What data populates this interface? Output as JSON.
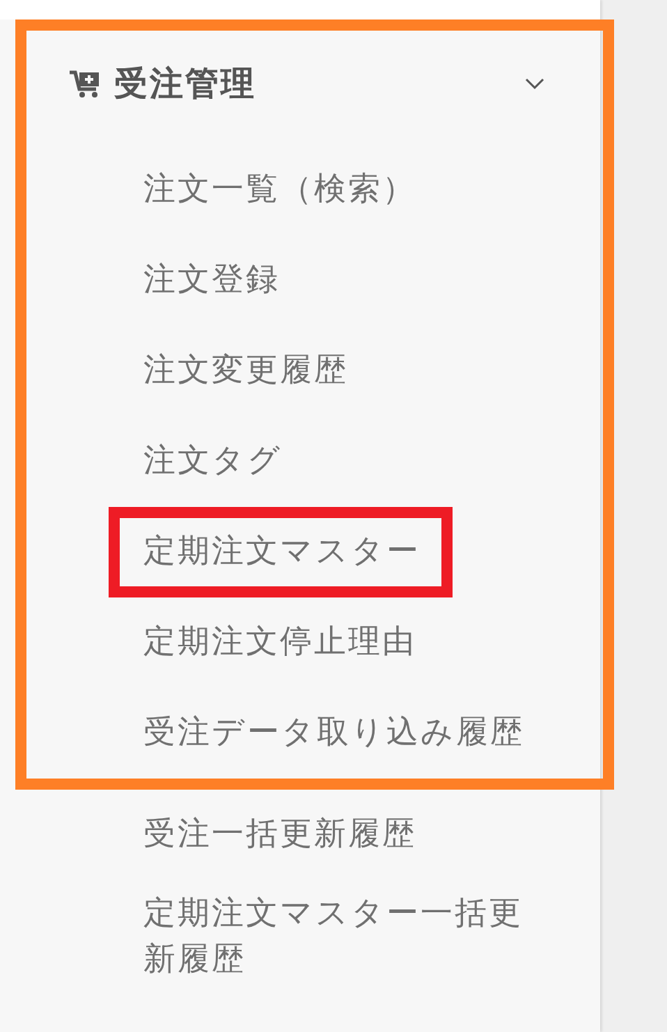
{
  "section": {
    "title": "受注管理",
    "expanded": true,
    "framed": true
  },
  "framed_items": [
    {
      "label": "注文一覧（検索）",
      "highlighted": false
    },
    {
      "label": "注文登録",
      "highlighted": false
    },
    {
      "label": "注文変更履歴",
      "highlighted": false
    },
    {
      "label": "注文タグ",
      "highlighted": false
    },
    {
      "label": "定期注文マスター",
      "highlighted": true
    },
    {
      "label": "定期注文停止理由",
      "highlighted": false
    },
    {
      "label": "受注データ取り込み履歴",
      "highlighted": false
    }
  ],
  "more_items": [
    {
      "label": "受注一括更新履歴",
      "highlighted": false
    },
    {
      "label": "定期注文マスター一括更新履歴",
      "highlighted": false
    }
  ]
}
